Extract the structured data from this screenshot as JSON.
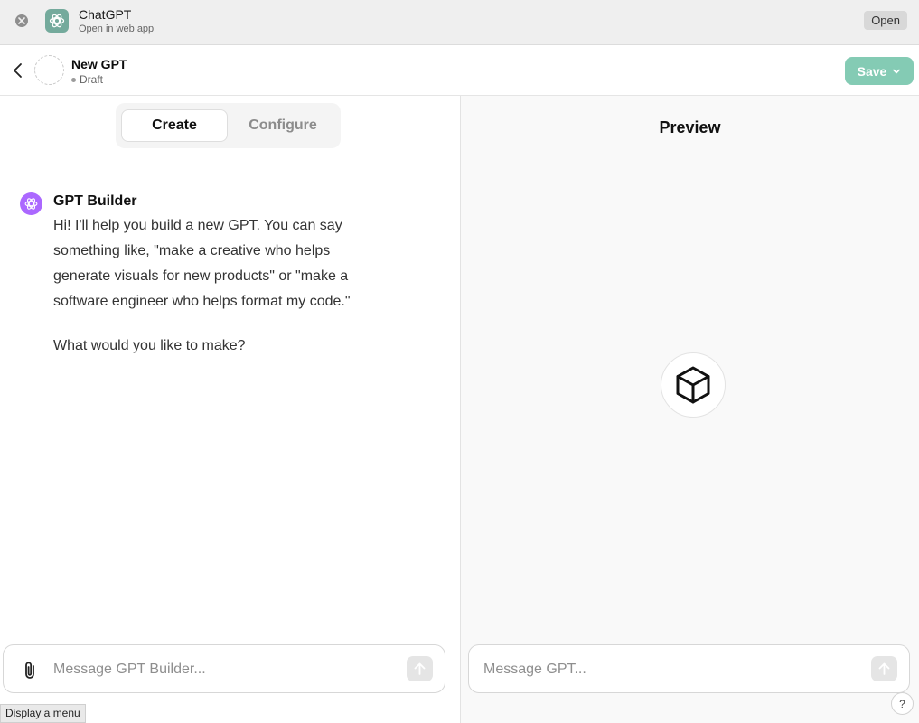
{
  "banner": {
    "app_name": "ChatGPT",
    "subtitle": "Open in web app",
    "open_label": "Open"
  },
  "header": {
    "gpt_name": "New GPT",
    "status": "Draft",
    "save_label": "Save"
  },
  "tabs": {
    "create": "Create",
    "configure": "Configure",
    "active": "Create"
  },
  "builder": {
    "name": "GPT Builder",
    "message": "Hi! I'll help you build a new GPT. You can say something like, \"make a creative who helps generate visuals for new products\" or \"make a software engineer who helps format my code.\"",
    "question": "What would you like to make?"
  },
  "left_composer": {
    "placeholder": "Message GPT Builder..."
  },
  "tooltip": "Display a menu",
  "preview": {
    "title": "Preview",
    "placeholder": "Message GPT...",
    "help_label": "?"
  },
  "colors": {
    "save_button": "#84cbb4",
    "builder_avatar": "#ab68ff",
    "app_icon": "#74aa9c"
  }
}
